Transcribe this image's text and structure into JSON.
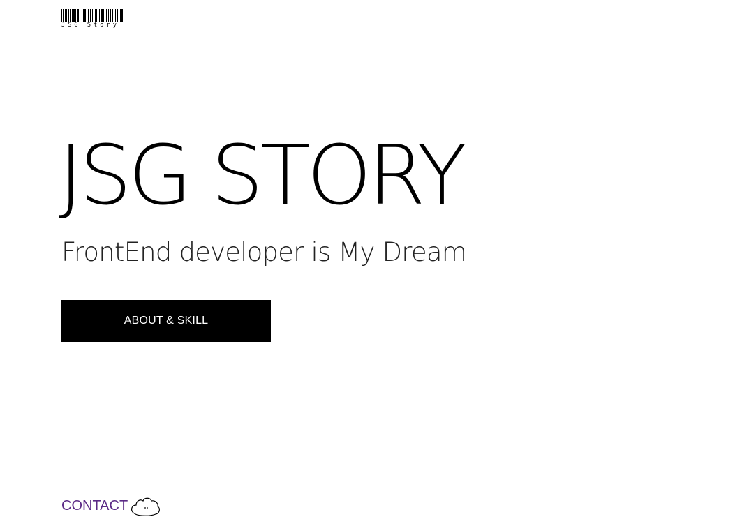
{
  "header": {
    "logo_text": "JSG Story"
  },
  "hero": {
    "title": "JSG STORY",
    "subtitle": "FrontEnd developer is My Dream",
    "button_label": "ABOUT & SKILL"
  },
  "footer": {
    "contact_label": "CONTACT",
    "contact_icon": "cloud-face-icon"
  },
  "colors": {
    "background": "#ffffff",
    "text": "#000000",
    "button_bg": "#000000",
    "button_text": "#ffffff",
    "contact_link": "#5b2a86"
  }
}
